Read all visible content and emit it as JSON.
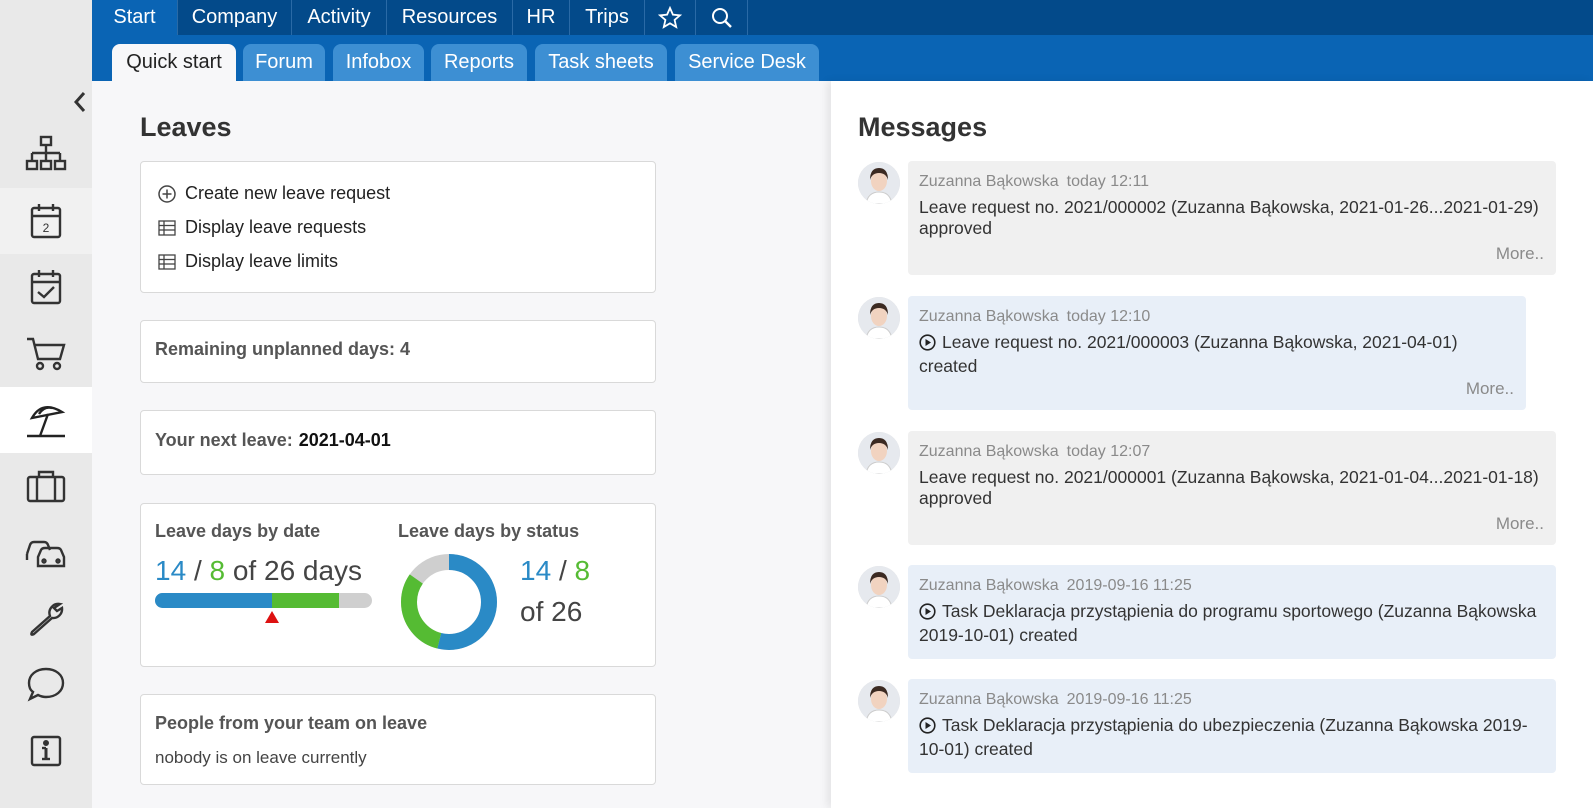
{
  "topnav": {
    "tabs": [
      "Start",
      "Company",
      "Activity",
      "Resources",
      "HR",
      "Trips"
    ],
    "icons": [
      "star-icon",
      "search-icon"
    ]
  },
  "subnav": {
    "tabs": [
      "Quick start",
      "Forum",
      "Infobox",
      "Reports",
      "Task sheets",
      "Service Desk"
    ]
  },
  "sidebar": {
    "calendar_day": "2",
    "items": [
      "org-chart-icon",
      "calendar-icon",
      "task-icon",
      "cart-icon",
      "beach-umbrella-icon",
      "briefcase-icon",
      "cars-icon",
      "wrench-icon",
      "chat-icon",
      "info-icon"
    ]
  },
  "leaves": {
    "title": "Leaves",
    "links": [
      "Create new leave request",
      "Display leave requests",
      "Display leave limits"
    ],
    "remaining_label": "Remaining unplanned days: 4",
    "next_leave_label": "Your next leave:",
    "next_leave_date": "2021-04-01",
    "by_date": {
      "title": "Leave days by date",
      "used": "14",
      "sep": "/",
      "planned": "8",
      "of_text": "of 26 days",
      "used_value": 14,
      "planned_value": 8,
      "total_value": 26
    },
    "by_status": {
      "title": "Leave days by status",
      "used": "14",
      "sep": "/",
      "planned": "8",
      "of_text": "of 26"
    },
    "team": {
      "title": "People from your team on leave",
      "text": "nobody is on leave currently"
    }
  },
  "colors": {
    "used": "#2a8ac6",
    "planned": "#55bb33",
    "remaining": "#cfcfcf",
    "marker": "#dd1111"
  },
  "messages": {
    "title": "Messages",
    "more_label": "More..",
    "items": [
      {
        "author": "Zuzanna Bąkowska",
        "time": "today 12:11",
        "line1": "Leave request no. 2021/000002 (Zuzanna Bąkowska, 2021-01-26...2021-01-29)",
        "line2": "approved"
      },
      {
        "author": "Zuzanna Bąkowska",
        "time": "today 12:10",
        "line1": "Leave request no. 2021/000003 (Zuzanna Bąkowska, 2021-04-01)",
        "line2": "created"
      },
      {
        "author": "Zuzanna Bąkowska",
        "time": "today 12:07",
        "line1": "Leave request no. 2021/000001 (Zuzanna Bąkowska, 2021-01-04...2021-01-18)",
        "line2": "approved"
      },
      {
        "author": "Zuzanna Bąkowska",
        "time": "2019-09-16 11:25",
        "line1": "Task Deklaracja przystąpienia do programu sportowego (Zuzanna Bąkowska",
        "line2": "2019-10-01) created"
      },
      {
        "author": "Zuzanna Bąkowska",
        "time": "2019-09-16 11:25",
        "line1": "Task Deklaracja przystąpienia do ubezpieczenia (Zuzanna Bąkowska 2019-",
        "line2": "10-01) created"
      }
    ]
  }
}
